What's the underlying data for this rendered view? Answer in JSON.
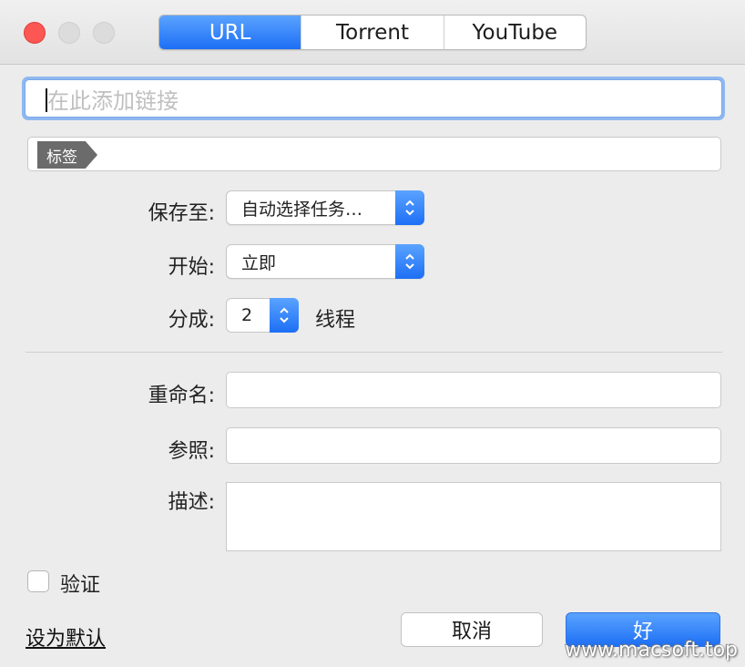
{
  "tabs": [
    {
      "label": "URL",
      "active": true
    },
    {
      "label": "Torrent",
      "active": false
    },
    {
      "label": "YouTube",
      "active": false
    }
  ],
  "url_field": {
    "placeholder": "在此添加链接"
  },
  "tag": {
    "chip": "标签"
  },
  "form": {
    "save_to": {
      "label": "保存至:",
      "value": "自动选择任务…"
    },
    "start": {
      "label": "开始:",
      "value": "立即"
    },
    "split": {
      "label": "分成:",
      "value": "2",
      "suffix": "线程"
    },
    "rename": {
      "label": "重命名:"
    },
    "referer": {
      "label": "参照:"
    },
    "description": {
      "label": "描述:"
    }
  },
  "verify": {
    "label": "验证",
    "checked": false
  },
  "set_default": "设为默认",
  "buttons": {
    "cancel": "取消",
    "ok": "好"
  },
  "watermark": "www.macsoft.top",
  "colors": {
    "accent": "#1d6ff5",
    "close": "#fc5753",
    "window_bg": "#ececec"
  }
}
